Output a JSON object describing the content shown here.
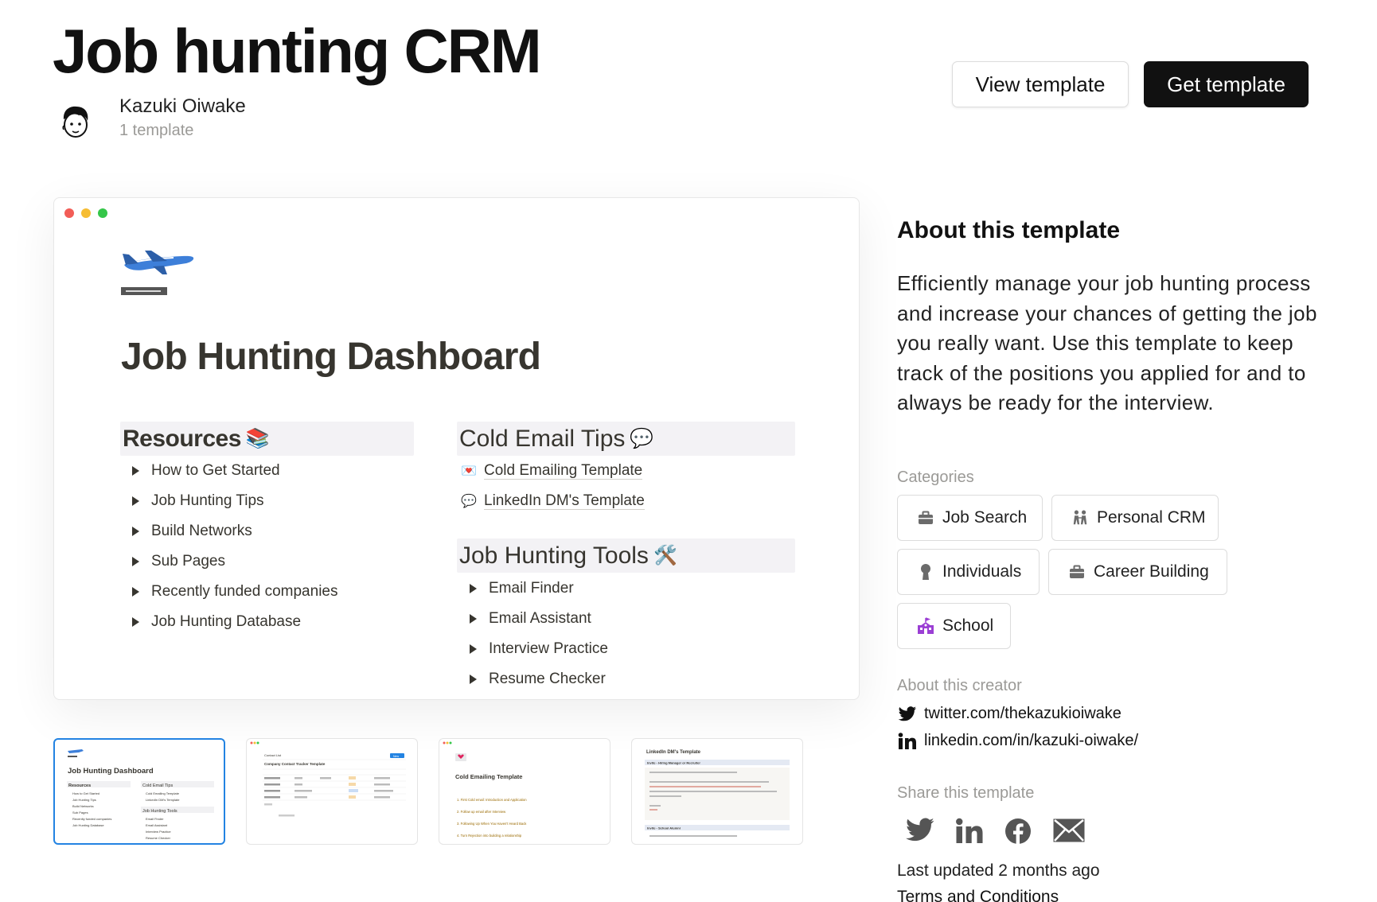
{
  "header": {
    "title": "Job hunting CRM",
    "creator_name": "Kazuki Oiwake",
    "creator_template_count": "1 template",
    "view_template_label": "View template",
    "get_template_label": "Get template"
  },
  "preview": {
    "dashboard_title": "Job Hunting Dashboard",
    "resources_heading": "Resources",
    "resources_items": [
      "How to Get Started",
      "Job Hunting Tips",
      "Build Networks",
      "Sub Pages",
      "Recently funded companies",
      "Job Hunting Database"
    ],
    "cold_email_heading": "Cold Email Tips",
    "cold_email_links": [
      "Cold Emailing Template",
      "LinkedIn DM's Template"
    ],
    "tools_heading": "Job Hunting Tools",
    "tools_items": [
      "Email Finder",
      "Email Assistant",
      "Interview Practice",
      "Resume Checker"
    ]
  },
  "thumbnails": {
    "t1": {
      "title": "Job Hunting Dashboard",
      "h1": "Resources",
      "h2": "Cold Email Tips",
      "h3": "Job Hunting Tools",
      "res": [
        "How to Get Started",
        "Job Hunting Tips",
        "Build Networks",
        "Sub Pages",
        "Recently funded companies",
        "Job Hunting Database"
      ],
      "cold": [
        "Cold Emailing Template",
        "LinkedIn DM's Template"
      ],
      "tools": [
        "Email Finder",
        "Email Assistant",
        "Interview Practice",
        "Resume Checker"
      ]
    },
    "t2": {
      "title": "Company Contact Tracker Template",
      "tab": "Contact List",
      "button": "New"
    },
    "t3": {
      "title": "Cold Emailing Template",
      "items": [
        "1. First Cold email: Introduction and Application",
        "2. Follow up email after Interview",
        "3. Following Up When You Haven't Heard Back",
        "4. Turn Rejection into building a relationship"
      ]
    },
    "t4": {
      "title": "LinkedIn DM's Template",
      "section1": "Invite - Hiring Manager or Recruiter",
      "section2": "Invite - School Alumni"
    }
  },
  "about": {
    "title": "About this template",
    "description": "Efficiently manage your job hunting process and increase your chances of getting the job you really want. Use this template to keep track of the positions you applied for and to always be ready for the interview."
  },
  "categories": {
    "label": "Categories",
    "items": [
      {
        "label": "Job Search",
        "icon": "briefcase-icon"
      },
      {
        "label": "Personal CRM",
        "icon": "people-icon"
      },
      {
        "label": "Individuals",
        "icon": "person-icon"
      },
      {
        "label": "Career Building",
        "icon": "briefcase-icon"
      },
      {
        "label": "School",
        "icon": "school-icon"
      }
    ]
  },
  "creator_section": {
    "label": "About this creator",
    "twitter": "twitter.com/thekazukioiwake",
    "linkedin": "linkedin.com/in/kazuki-oiwake/"
  },
  "share": {
    "label": "Share this template",
    "icons": [
      "twitter-icon",
      "linkedin-icon",
      "facebook-icon",
      "email-icon"
    ]
  },
  "footer": {
    "last_updated": "Last updated 2 months ago",
    "terms": "Terms and Conditions"
  },
  "colors": {
    "accent": "#2383e2",
    "primary_button": "#111111",
    "muted_text": "#9b9a97",
    "school_icon": "#9b3fd4"
  }
}
